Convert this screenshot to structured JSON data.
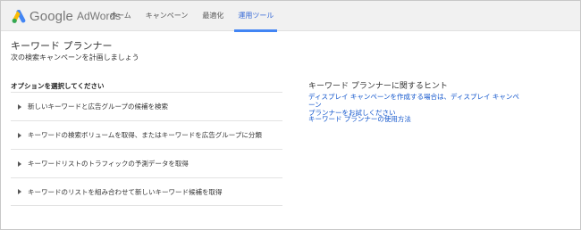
{
  "header": {
    "logo_google": "Google",
    "logo_product": "AdWords",
    "nav": [
      {
        "label": "ホーム",
        "active": false
      },
      {
        "label": "キャンペーン",
        "active": false
      },
      {
        "label": "最適化",
        "active": false
      },
      {
        "label": "運用ツール",
        "active": true
      }
    ]
  },
  "main": {
    "title": "キーワード プランナー",
    "subtitle": "次の検索キャンペーンを計画しましょう",
    "options_heading": "オプションを選択してください",
    "options": [
      {
        "label": "新しいキーワードと広告グループの候補を検索"
      },
      {
        "label": "キーワードの検索ボリュームを取得、またはキーワードを広告グループに分類"
      },
      {
        "label": "キーワードリストのトラフィックの予測データを取得"
      },
      {
        "label": "キーワードのリストを組み合わせて新しいキーワード候補を取得"
      }
    ]
  },
  "tips": {
    "title": "キーワード プランナーに関するヒント",
    "links": [
      {
        "label_line1": "ディスプレイ キャンペーンを作成する場合は、ディスプレイ キャンペーン",
        "label_line2": "プランナーをお試しください"
      },
      {
        "label_line1": "キーワード プランナーの使用方法",
        "label_line2": ""
      }
    ]
  },
  "colors": {
    "accent": "#4285f4",
    "link": "#1155cc",
    "topbar": "#f1f1f1"
  }
}
